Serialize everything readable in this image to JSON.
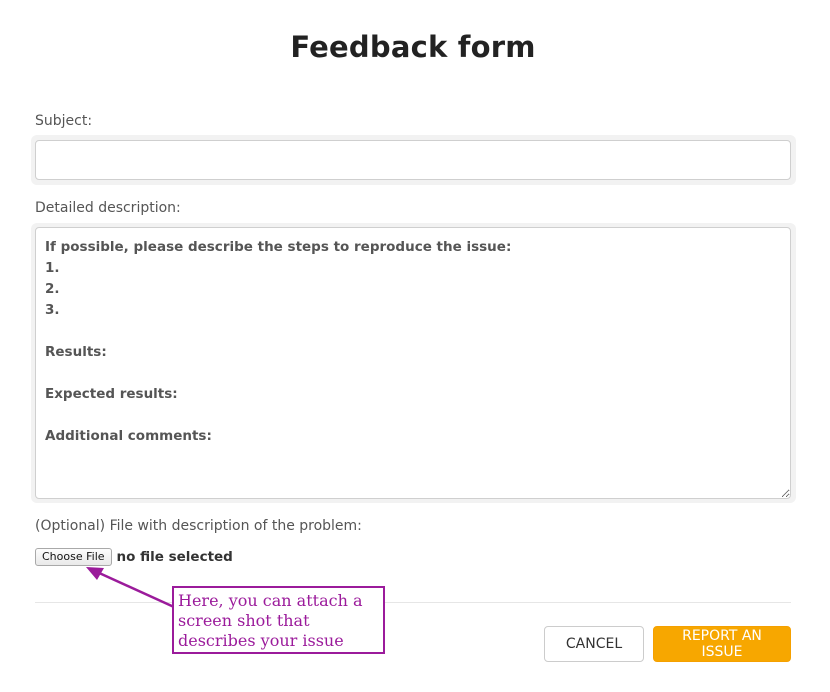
{
  "form": {
    "title": "Feedback form",
    "subject_label": "Subject:",
    "subject_value": "",
    "description_label": "Detailed description:",
    "description_value": "If possible, please describe the steps to reproduce the issue:\n1.\n2.\n3.\n\nResults:\n\nExpected results:\n\nAdditional comments:",
    "file_label": "(Optional) File with description of the problem:",
    "choose_file_label": "Choose File",
    "file_status": "no file selected",
    "cancel_label": "CANCEL",
    "report_label": "REPORT AN ISSUE"
  },
  "annotation": {
    "text": "Here, you can attach a screen shot that describes your issue",
    "color": "#9b1b9b"
  },
  "colors": {
    "accent": "#f7a700"
  }
}
